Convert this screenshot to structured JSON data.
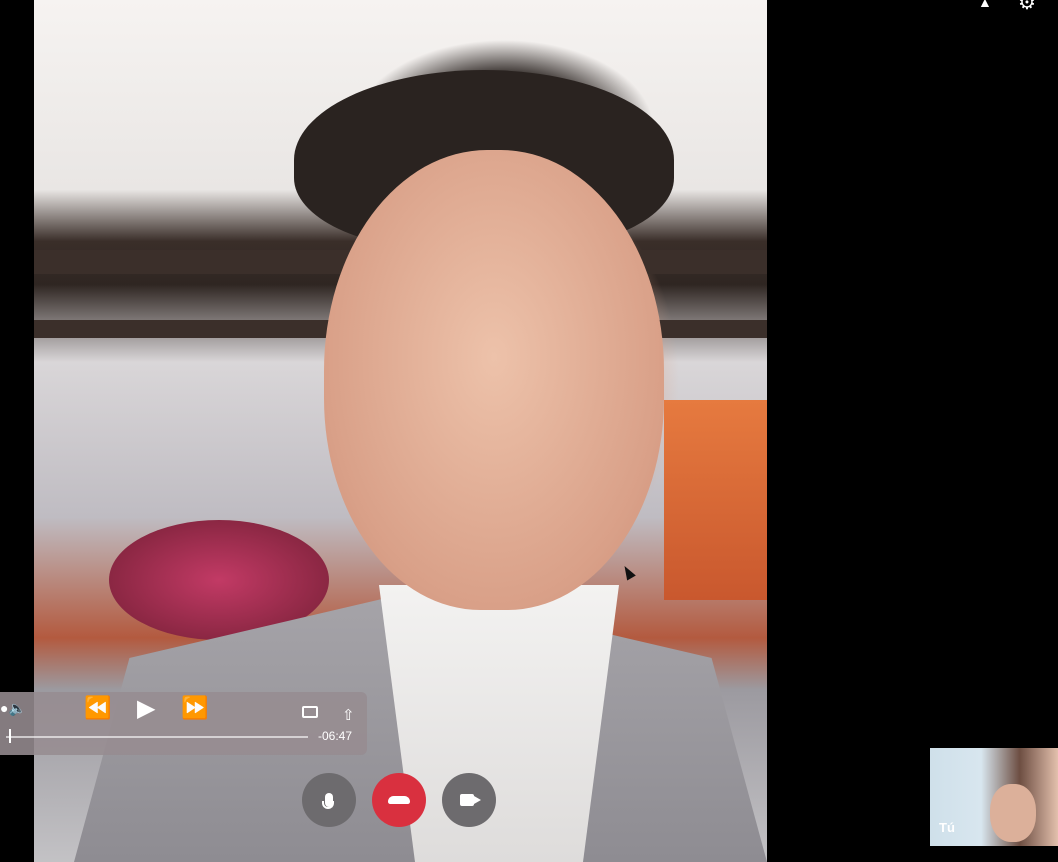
{
  "call": {
    "self_label": "Tú"
  },
  "player": {
    "time_remaining": "-06:47",
    "progress": 0.01
  },
  "icons": {
    "volume": "volume-icon",
    "rewind": "rewind-icon",
    "play": "play-icon",
    "forward": "fast-forward-icon",
    "airplay": "airplay-icon",
    "share": "share-icon",
    "mic": "microphone-icon",
    "end_call": "hang-up-icon",
    "camera": "video-camera-icon",
    "person": "person-icon",
    "gear": "gear-icon"
  },
  "colors": {
    "end_call": "#d9303f",
    "control_bg": "#6d6b6e"
  }
}
